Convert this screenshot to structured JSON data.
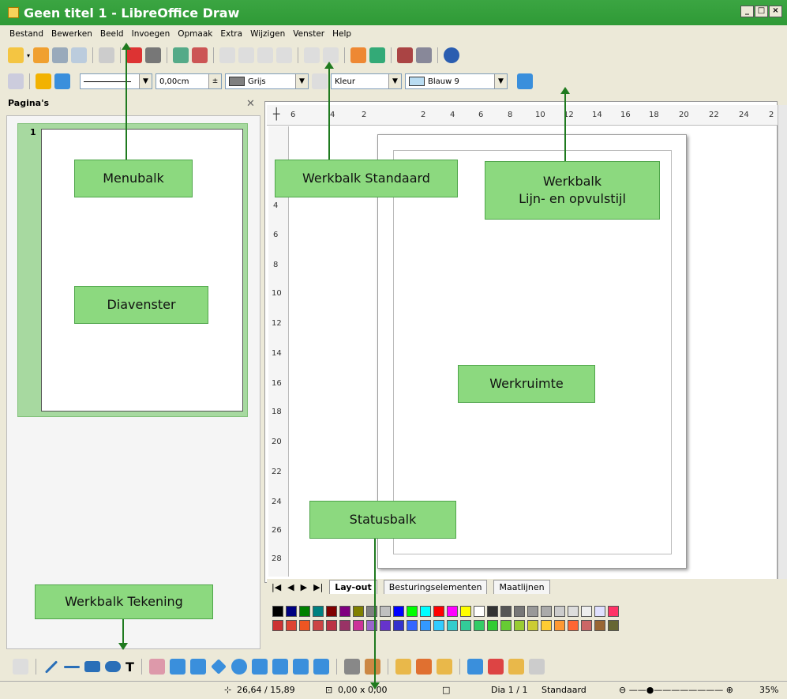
{
  "window": {
    "title": "Geen titel 1 - LibreOffice Draw"
  },
  "menu": [
    "Bestand",
    "Bewerken",
    "Beeld",
    "Invoegen",
    "Opmaak",
    "Extra",
    "Wijzigen",
    "Venster",
    "Help"
  ],
  "line_toolbar": {
    "line_width": "0,00cm",
    "line_color": "Grijs",
    "area_style": "Kleur",
    "area_color": "Blauw 9"
  },
  "slides_panel": {
    "title": "Pagina's",
    "slide_number": "1"
  },
  "ruler_h": [
    "6",
    "4",
    "2",
    "2",
    "4",
    "6",
    "8",
    "10",
    "12",
    "14",
    "16",
    "18",
    "20",
    "22",
    "24",
    "2"
  ],
  "ruler_v": [
    "4",
    "6",
    "8",
    "10",
    "12",
    "14",
    "16",
    "18",
    "20",
    "22",
    "24",
    "26",
    "28"
  ],
  "tabs": [
    "Lay-out",
    "Besturingselementen",
    "Maatlijnen"
  ],
  "status": {
    "position": "26,64 / 15,89",
    "size": "0,00 x 0,00",
    "slide": "Dia 1 / 1",
    "layout": "Standaard",
    "zoom": "35%"
  },
  "callouts": {
    "menubar": "Menubalk",
    "standard": "Werkbalk Standaard",
    "linefill_1": "Werkbalk",
    "linefill_2": "Lijn- en opvulstijl",
    "slidepane": "Diavenster",
    "workspace": "Werkruimte",
    "statusbar": "Statusbalk",
    "drawing": "Werkbalk Tekening"
  },
  "palette_colors": [
    "#000000",
    "#000080",
    "#008000",
    "#008080",
    "#800000",
    "#800080",
    "#808000",
    "#808080",
    "#c0c0c0",
    "#0000ff",
    "#00ff00",
    "#00ffff",
    "#ff0000",
    "#ff00ff",
    "#ffff00",
    "#ffffff",
    "#333333",
    "#555555",
    "#777777",
    "#999999",
    "#aaaaaa",
    "#cccccc",
    "#dddddd",
    "#eeeeee",
    "#e0e0ff",
    "#ff3366",
    "#cc3333",
    "#dd4433",
    "#ee5522",
    "#cc4444",
    "#bb3344",
    "#993366",
    "#cc3399",
    "#9966cc",
    "#6633cc",
    "#3333cc",
    "#3366ff",
    "#3399ff",
    "#33ccff",
    "#33cccc",
    "#33cc99",
    "#33cc66",
    "#33cc33",
    "#66cc33",
    "#99cc33",
    "#cccc33",
    "#ffcc33",
    "#ff9933",
    "#ff6633",
    "#cc6666",
    "#996633",
    "#666633"
  ]
}
